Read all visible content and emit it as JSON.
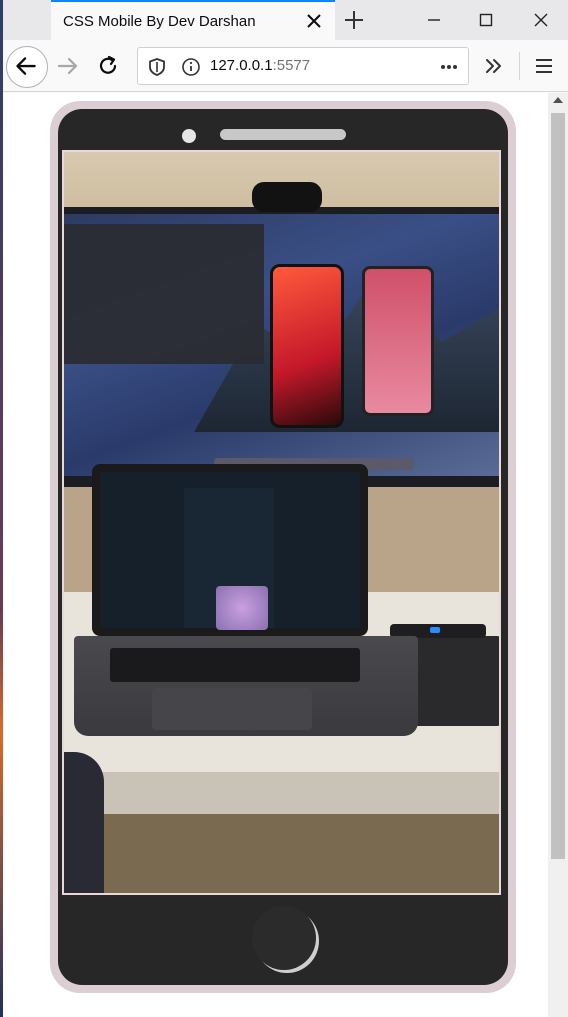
{
  "browser": {
    "tab_title": "CSS Mobile By Dev Darshan",
    "url_host": "127.0.0.1",
    "url_port": ":5577"
  },
  "icons": {
    "back": "back-arrow-icon",
    "forward": "forward-arrow-icon",
    "reload": "reload-icon",
    "shield": "shield-icon",
    "info": "info-icon",
    "page_actions": "more-dots-icon",
    "overflow": "chevron-double-right-icon",
    "menu": "hamburger-menu-icon",
    "close_tab": "close-icon",
    "new_tab": "plus-icon",
    "minimize": "minimize-icon",
    "maximize": "maximize-icon",
    "close_window": "close-window-icon"
  },
  "colors": {
    "tab_accent": "#0a84ff",
    "phone_frame": "#dccfd3",
    "phone_body": "#272727"
  }
}
